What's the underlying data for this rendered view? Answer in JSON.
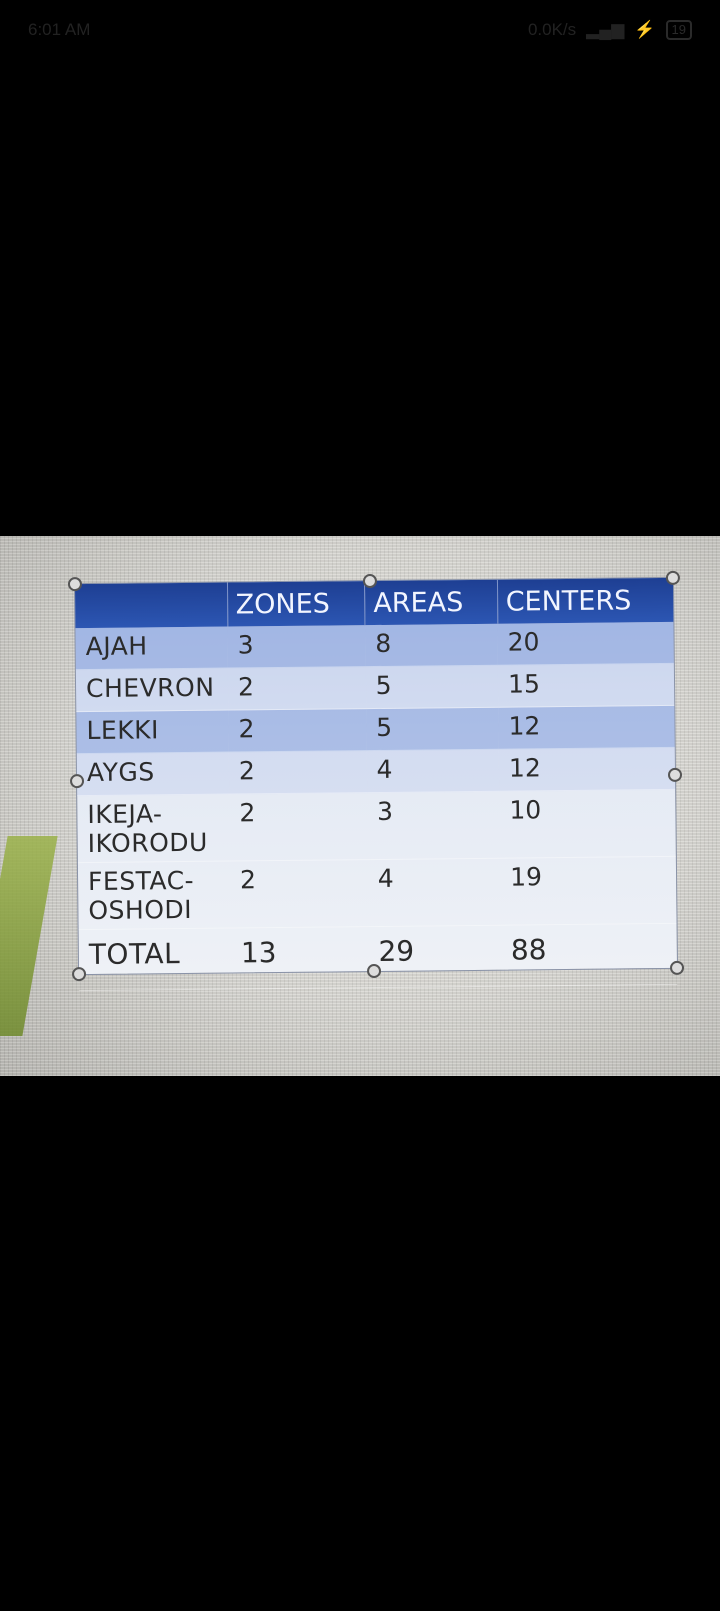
{
  "status_bar": {
    "time": "6:01 AM",
    "signal_text": "0.0K/s",
    "battery": "19"
  },
  "table": {
    "headers": [
      "",
      "ZONES",
      "AREAS",
      "CENTERS"
    ],
    "rows": [
      {
        "label": "AJAH",
        "zones": "3",
        "areas": "8",
        "centers": "20"
      },
      {
        "label": "CHEVRON",
        "zones": "2",
        "areas": "5",
        "centers": "15"
      },
      {
        "label": "LEKKI",
        "zones": "2",
        "areas": "5",
        "centers": "12"
      },
      {
        "label": "AYGS",
        "zones": "2",
        "areas": "4",
        "centers": "12"
      },
      {
        "label": "IKEJA-IKORODU",
        "zones": "2",
        "areas": "3",
        "centers": "10"
      },
      {
        "label": "FESTAC-OSHODI",
        "zones": "2",
        "areas": "4",
        "centers": "19"
      }
    ],
    "total": {
      "label": "TOTAL",
      "zones": "13",
      "areas": "29",
      "centers": "88"
    }
  }
}
